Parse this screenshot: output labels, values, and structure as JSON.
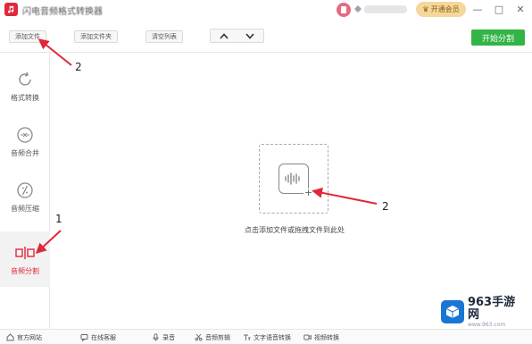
{
  "window": {
    "title": "闪电音频格式转换器",
    "vip_label": "开通会员",
    "minimize": "—",
    "maximize": "□",
    "close": "✕"
  },
  "toolbar": {
    "add_files": "添加文件",
    "add_folder": "添加文件夹",
    "clear_list": "清空列表",
    "move_up": "∧",
    "move_down": "∨",
    "start_split": "开始分割"
  },
  "sidebar": {
    "items": [
      {
        "label": "格式转换",
        "icon": "refresh-icon"
      },
      {
        "label": "音频合并",
        "icon": "merge-icon"
      },
      {
        "label": "音频压缩",
        "icon": "compress-icon"
      },
      {
        "label": "音频分割",
        "icon": "split-icon",
        "active": true
      }
    ]
  },
  "main": {
    "drop_hint": "点击添加文件或拖拽文件到此处"
  },
  "annotations": {
    "num_toolbar": "2",
    "num_sidebar": "1",
    "num_dropzone": "2"
  },
  "bottombar": {
    "items": [
      {
        "label": "官方网站",
        "icon": "home-icon"
      },
      {
        "label": "在线客服",
        "icon": "chat-icon"
      },
      {
        "label": "录音",
        "icon": "mic-icon"
      },
      {
        "label": "音频剪辑",
        "icon": "scissors-icon"
      },
      {
        "label": "文字语音转换",
        "icon": "text-voice-icon"
      },
      {
        "label": "视频转换",
        "icon": "video-icon"
      }
    ]
  },
  "watermark": {
    "main": "963手游网",
    "sub": "www.963.com"
  },
  "colors": {
    "brand_red": "#e0283a",
    "start_green": "#33b446",
    "vip_gold": "#f6d79a",
    "arrow_red": "#e0283a"
  }
}
